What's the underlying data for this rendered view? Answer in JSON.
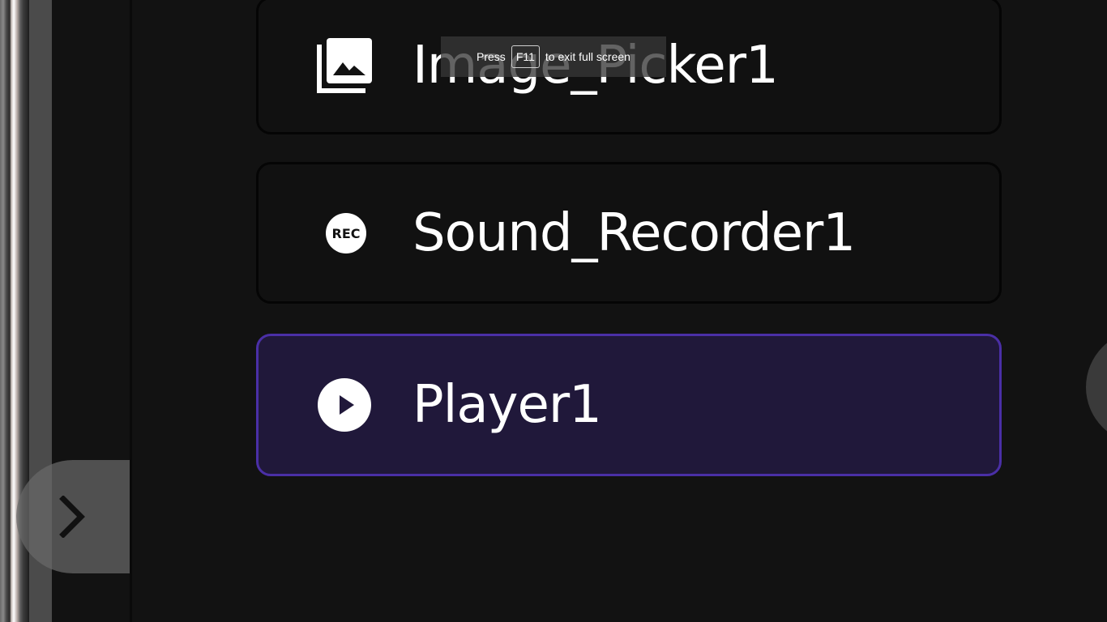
{
  "components": [
    {
      "label": "Image_Picker1",
      "icon": "image-gallery-icon",
      "selected": false
    },
    {
      "label": "Sound_Recorder1",
      "icon": "rec-icon",
      "selected": false,
      "icon_text": "REC"
    },
    {
      "label": "Player1",
      "icon": "play-circle-icon",
      "selected": true
    }
  ],
  "fullscreen_notice": {
    "press": "Press",
    "key": "F11",
    "suffix": "to exit full screen"
  },
  "drawer_toggle": {
    "icon": "chevron-right-icon"
  },
  "colors": {
    "background": "#121212",
    "card": "#111111",
    "selected_card": "#20183a",
    "selected_border": "#4a2fa6",
    "text": "#ffffff"
  }
}
